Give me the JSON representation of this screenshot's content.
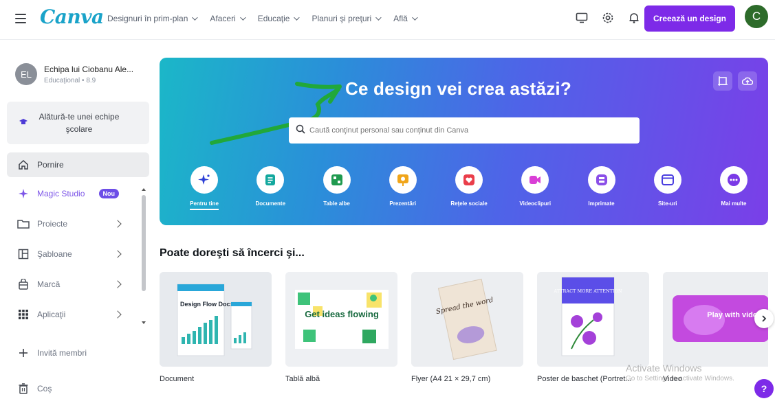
{
  "topbar": {
    "logo": "Canva",
    "nav": [
      "Designuri în prim-plan",
      "Afaceri",
      "Educaţie",
      "Planuri şi preţuri",
      "Află"
    ],
    "create_label": "Creează un design",
    "avatar_initial": "C"
  },
  "sidebar": {
    "team_initials": "EL",
    "team_name": "Echipa lui Ciobanu Ale...",
    "team_sub": "Educaţional • 8.9",
    "join_label": "Alătură-te unei echipe şcolare",
    "items": [
      {
        "label": "Pornire",
        "icon": "home-icon"
      },
      {
        "label": "Magic Studio",
        "icon": "sparkle-icon",
        "badge": "Nou"
      },
      {
        "label": "Proiecte",
        "icon": "folder-icon"
      },
      {
        "label": "Şabloane",
        "icon": "template-icon"
      },
      {
        "label": "Marcă",
        "icon": "brand-icon"
      },
      {
        "label": "Aplicaţii",
        "icon": "apps-icon"
      },
      {
        "label": "Invită membri",
        "icon": "plus-icon"
      },
      {
        "label": "Coş",
        "icon": "trash-icon"
      }
    ]
  },
  "hero": {
    "title": "Ce design vei crea astăzi?",
    "search_placeholder": "Caută conţinut personal sau conţinut din Canva",
    "categories": [
      {
        "label": "Pentru tine",
        "icon": "sparkle-icon",
        "color": "#3a5ae8"
      },
      {
        "label": "Documente",
        "icon": "document-icon",
        "color": "#14b8a6"
      },
      {
        "label": "Table albe",
        "icon": "whiteboard-icon",
        "color": "#22a05b"
      },
      {
        "label": "Prezentări",
        "icon": "presentation-icon",
        "color": "#f59e0b"
      },
      {
        "label": "Reţele sociale",
        "icon": "heart-icon",
        "color": "#ef4444"
      },
      {
        "label": "Videoclipuri",
        "icon": "video-icon",
        "color": "#d946ef"
      },
      {
        "label": "Imprimate",
        "icon": "print-icon",
        "color": "#8b5cf6"
      },
      {
        "label": "Site-uri",
        "icon": "website-icon",
        "color": "#5b4ee8"
      },
      {
        "label": "Mai multe",
        "icon": "more-icon",
        "color": "#7c3aed"
      }
    ]
  },
  "suggestions": {
    "title": "Poate doreşti să încerci şi...",
    "cards": [
      {
        "label": "Document"
      },
      {
        "label": "Tablă albă",
        "thumb_text": "Get ideas flowing"
      },
      {
        "label": "Flyer (A4 21 × 29,7 cm)",
        "thumb_text": "Spread the word"
      },
      {
        "label": "Poster de baschet (Portret..."
      },
      {
        "label": "Video",
        "thumb_text": "Play with video"
      }
    ],
    "doc_thumb_text": "Design Flow Docs",
    "poster_thumb_text": "ATTRACT MORE ATTENTION"
  },
  "watermark": {
    "line1": "Activate Windows",
    "line2": "Go to Settings to activate Windows."
  },
  "help_label": "?"
}
